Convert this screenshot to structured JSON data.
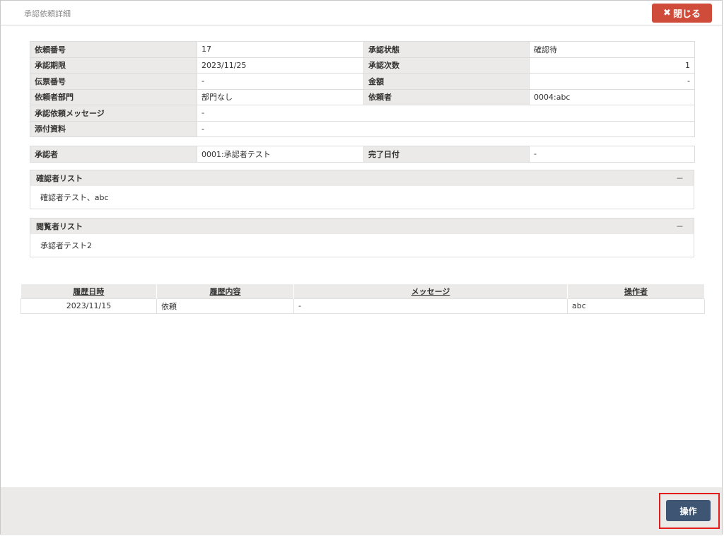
{
  "dialog": {
    "title": "承認依頼詳細",
    "close_label": "閉じる"
  },
  "info": {
    "rows": [
      {
        "l1": "依頼番号",
        "v1": "17",
        "l2": "承認状態",
        "v2": "確認待"
      },
      {
        "l1": "承認期限",
        "v1": "2023/11/25",
        "l2": "承認次数",
        "v2": "1"
      },
      {
        "l1": "伝票番号",
        "v1": "-",
        "l2": "金額",
        "v2": "-"
      },
      {
        "l1": "依頼者部門",
        "v1": "部門なし",
        "l2": "依頼者",
        "v2": "0004:abc"
      }
    ],
    "message_label": "承認依頼メッセージ",
    "message_value": "-",
    "attach_label": "添付資料",
    "attach_value": "-"
  },
  "approver": {
    "label": "承認者",
    "value": "0001:承認者テスト",
    "done_label": "完了日付",
    "done_value": "-"
  },
  "confirmers": {
    "title": "確認者リスト",
    "collapse": "－",
    "body": "確認者テスト、abc"
  },
  "viewers": {
    "title": "閲覧者リスト",
    "collapse": "－",
    "body": "承認者テスト2"
  },
  "history": {
    "headers": [
      "履歴日時",
      "履歴内容",
      "メッセージ",
      "操作者"
    ],
    "rows": [
      {
        "date": "2023/11/15",
        "content": "依頼",
        "message": "-",
        "operator": "abc"
      }
    ]
  },
  "footer": {
    "operate_label": "操作"
  },
  "colors": {
    "close_button": "#cf4b3a",
    "operate_button": "#3e5574",
    "highlight_frame": "#e21b1b"
  }
}
